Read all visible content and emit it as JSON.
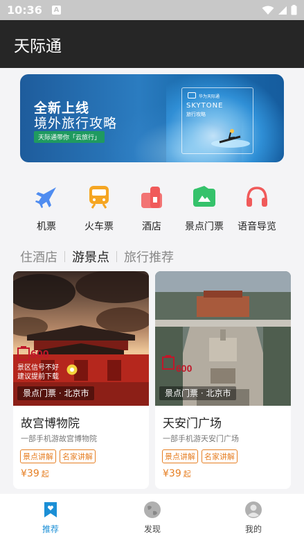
{
  "status_bar": {
    "time": "10:36",
    "badge": "A"
  },
  "app_bar": {
    "title": "天际通"
  },
  "banner": {
    "headline": "全新上线",
    "subheadline": "境外旅行攻略",
    "pill": "天际通带你「云旅行」",
    "book_brand": "华为天际通",
    "book_title": "SKYTONE",
    "book_subtitle": "旅行攻略"
  },
  "quick_icons": [
    {
      "label": "机票",
      "icon": "airplane-icon",
      "color": "#4f8cf0"
    },
    {
      "label": "火车票",
      "icon": "train-icon",
      "color": "#f5a623"
    },
    {
      "label": "酒店",
      "icon": "hotel-icon",
      "color": "#f05a5a"
    },
    {
      "label": "景点门票",
      "icon": "ticket-icon",
      "color": "#35c26b"
    },
    {
      "label": "语音导览",
      "icon": "headphones-icon",
      "color": "#f05a5a"
    }
  ],
  "tabs": [
    {
      "label": "住酒店",
      "active": false
    },
    {
      "label": "游景点",
      "active": true
    },
    {
      "label": "旅行推荐",
      "active": false
    }
  ],
  "cards": [
    {
      "category": "景点门票 · 北京市",
      "name": "故宫博物院",
      "desc": "一部手机游故宫博物院",
      "tags": [
        "景点讲解",
        "名家讲解"
      ],
      "price": "¥39",
      "price_unit": "起",
      "badge": "600",
      "notice_line1": "景区信号不好",
      "notice_line2": "建议提前下载"
    },
    {
      "category": "景点门票 · 北京市",
      "name": "天安门广场",
      "desc": "一部手机游天安门广场",
      "tags": [
        "景点讲解",
        "名家讲解"
      ],
      "price": "¥39",
      "price_unit": "起",
      "badge": "600"
    }
  ],
  "bottom_nav": [
    {
      "label": "推荐",
      "icon": "recommend-icon",
      "active": true
    },
    {
      "label": "发现",
      "icon": "globe-icon",
      "active": false
    },
    {
      "label": "我的",
      "icon": "profile-icon",
      "active": false
    }
  ],
  "colors": {
    "accent": "#1b8fd6",
    "price": "#e67e22",
    "appbar": "#262626"
  }
}
